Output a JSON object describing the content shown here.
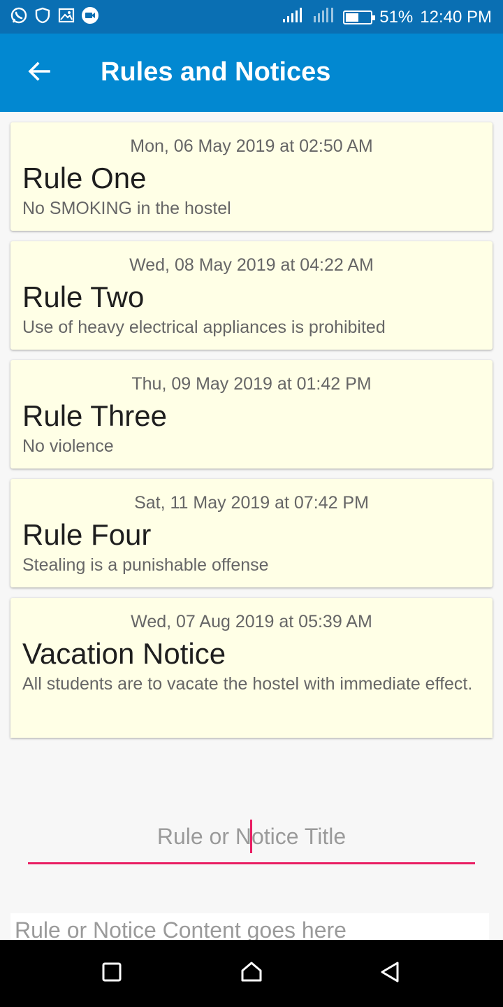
{
  "status_bar": {
    "left_icons": [
      "whatsapp-icon",
      "shield-icon",
      "image-icon",
      "video-call-icon"
    ],
    "signal_icons": [
      "signal-icon",
      "data-signal-icon"
    ],
    "battery_percent": "51%",
    "battery_level": 0.51,
    "time": "12:40 PM"
  },
  "app_bar": {
    "back_icon": "arrow-left-icon",
    "title": "Rules and Notices",
    "color": "#0288d1"
  },
  "notices": [
    {
      "date": "Mon, 06 May 2019 at 02:50 AM",
      "title": "Rule One",
      "content": "No SMOKING in the hostel"
    },
    {
      "date": "Wed, 08 May 2019 at 04:22 AM",
      "title": "Rule Two",
      "content": "Use of heavy electrical appliances is prohibited"
    },
    {
      "date": "Thu, 09 May 2019 at 01:42 PM",
      "title": "Rule Three",
      "content": "No violence"
    },
    {
      "date": "Sat, 11 May 2019 at 07:42 PM",
      "title": "Rule Four",
      "content": "Stealing is a punishable offense"
    },
    {
      "date": "Wed, 07 Aug 2019 at 05:39 AM",
      "title": "Vacation Notice",
      "content": "All students are to vacate the hostel with immediate effect."
    }
  ],
  "form": {
    "title_placeholder": "Rule or Notice Title",
    "content_placeholder": "Rule or Notice Content goes here",
    "accent_color": "#e91e63"
  },
  "nav_bar": {
    "icons": [
      "recent-apps-icon",
      "home-icon",
      "back-icon"
    ]
  }
}
